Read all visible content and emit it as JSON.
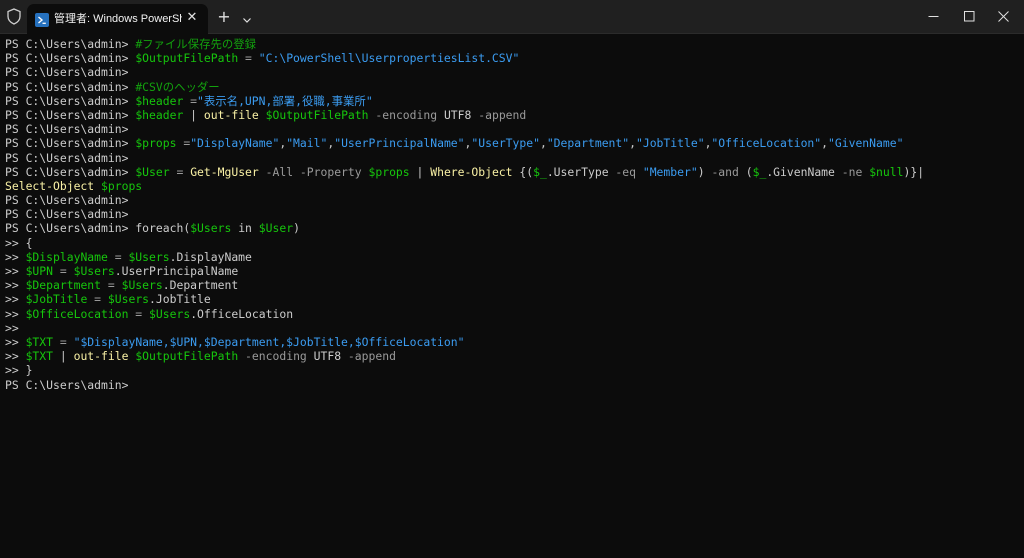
{
  "tab": {
    "title": "管理者: Windows PowerShell",
    "close_glyph": "✕",
    "new_tab_glyph": "+"
  },
  "window": {
    "minimize_icon": "minimize-icon",
    "maximize_icon": "maximize-icon",
    "close_icon": "close-icon"
  },
  "colors": {
    "background": "#0c0c0c",
    "titlebar": "#202020",
    "default_text": "#cccccc",
    "comment": "#13a10e",
    "variable": "#16c60c",
    "string": "#3b9cf1",
    "command": "#f9f1a5",
    "parameter": "#9a9a9a"
  },
  "terminal": {
    "lines": [
      [
        {
          "t": "PS C:\\Users\\admin> ",
          "c": "def"
        },
        {
          "t": "#ファイル保存先の登録",
          "c": "cmt"
        }
      ],
      [
        {
          "t": "PS C:\\Users\\admin> ",
          "c": "def"
        },
        {
          "t": "$OutputFilePath",
          "c": "var"
        },
        {
          "t": " = ",
          "c": "op"
        },
        {
          "t": "\"C:\\PowerShell\\UserpropertiesList.CSV\"",
          "c": "str"
        }
      ],
      [
        {
          "t": "PS C:\\Users\\admin>",
          "c": "def"
        }
      ],
      [
        {
          "t": "PS C:\\Users\\admin> ",
          "c": "def"
        },
        {
          "t": "#CSVのヘッダー",
          "c": "cmt"
        }
      ],
      [
        {
          "t": "PS C:\\Users\\admin> ",
          "c": "def"
        },
        {
          "t": "$header",
          "c": "var"
        },
        {
          "t": " =",
          "c": "op"
        },
        {
          "t": "\"表示名,UPN,部署,役職,事業所\"",
          "c": "str"
        }
      ],
      [
        {
          "t": "PS C:\\Users\\admin> ",
          "c": "def"
        },
        {
          "t": "$header",
          "c": "var"
        },
        {
          "t": " | ",
          "c": "bar"
        },
        {
          "t": "out-file",
          "c": "cmd"
        },
        {
          "t": " ",
          "c": "def"
        },
        {
          "t": "$OutputFilePath",
          "c": "var"
        },
        {
          "t": " -encoding ",
          "c": "par"
        },
        {
          "t": "UTF8",
          "c": "def"
        },
        {
          "t": " -append",
          "c": "par"
        }
      ],
      [
        {
          "t": "PS C:\\Users\\admin>",
          "c": "def"
        }
      ],
      [
        {
          "t": "PS C:\\Users\\admin> ",
          "c": "def"
        },
        {
          "t": "$props",
          "c": "var"
        },
        {
          "t": " =",
          "c": "op"
        },
        {
          "t": "\"DisplayName\"",
          "c": "str"
        },
        {
          "t": ",",
          "c": "def"
        },
        {
          "t": "\"Mail\"",
          "c": "str"
        },
        {
          "t": ",",
          "c": "def"
        },
        {
          "t": "\"UserPrincipalName\"",
          "c": "str"
        },
        {
          "t": ",",
          "c": "def"
        },
        {
          "t": "\"UserType\"",
          "c": "str"
        },
        {
          "t": ",",
          "c": "def"
        },
        {
          "t": "\"Department\"",
          "c": "str"
        },
        {
          "t": ",",
          "c": "def"
        },
        {
          "t": "\"JobTitle\"",
          "c": "str"
        },
        {
          "t": ",",
          "c": "def"
        },
        {
          "t": "\"OfficeLocation\"",
          "c": "str"
        },
        {
          "t": ",",
          "c": "def"
        },
        {
          "t": "\"GivenName\"",
          "c": "str"
        }
      ],
      [
        {
          "t": "PS C:\\Users\\admin>",
          "c": "def"
        }
      ],
      [
        {
          "t": "PS C:\\Users\\admin> ",
          "c": "def"
        },
        {
          "t": "$User",
          "c": "var"
        },
        {
          "t": " = ",
          "c": "op"
        },
        {
          "t": "Get-MgUser",
          "c": "cmd"
        },
        {
          "t": " -All -Property ",
          "c": "par"
        },
        {
          "t": "$props",
          "c": "var"
        },
        {
          "t": " | ",
          "c": "bar"
        },
        {
          "t": "Where-Object",
          "c": "cmd"
        },
        {
          "t": " {(",
          "c": "def"
        },
        {
          "t": "$_",
          "c": "var"
        },
        {
          "t": ".UserType ",
          "c": "def"
        },
        {
          "t": "-eq",
          "c": "par"
        },
        {
          "t": " ",
          "c": "def"
        },
        {
          "t": "\"Member\"",
          "c": "str"
        },
        {
          "t": ") ",
          "c": "def"
        },
        {
          "t": "-and",
          "c": "par"
        },
        {
          "t": " (",
          "c": "def"
        },
        {
          "t": "$_",
          "c": "var"
        },
        {
          "t": ".GivenName ",
          "c": "def"
        },
        {
          "t": "-ne",
          "c": "par"
        },
        {
          "t": " ",
          "c": "def"
        },
        {
          "t": "$null",
          "c": "var"
        },
        {
          "t": ")}|",
          "c": "def"
        }
      ],
      [
        {
          "t": "Select-Object",
          "c": "cmd"
        },
        {
          "t": " ",
          "c": "def"
        },
        {
          "t": "$props",
          "c": "var"
        }
      ],
      [
        {
          "t": "PS C:\\Users\\admin>",
          "c": "def"
        }
      ],
      [
        {
          "t": "PS C:\\Users\\admin>",
          "c": "def"
        }
      ],
      [
        {
          "t": "PS C:\\Users\\admin> ",
          "c": "def"
        },
        {
          "t": "foreach(",
          "c": "def"
        },
        {
          "t": "$Users",
          "c": "var"
        },
        {
          "t": " in ",
          "c": "def"
        },
        {
          "t": "$User",
          "c": "var"
        },
        {
          "t": ")",
          "c": "def"
        }
      ],
      [
        {
          "t": ">> {",
          "c": "def"
        }
      ],
      [
        {
          "t": ">> ",
          "c": "def"
        },
        {
          "t": "$DisplayName",
          "c": "var"
        },
        {
          "t": " = ",
          "c": "op"
        },
        {
          "t": "$Users",
          "c": "var"
        },
        {
          "t": ".DisplayName",
          "c": "def"
        }
      ],
      [
        {
          "t": ">> ",
          "c": "def"
        },
        {
          "t": "$UPN",
          "c": "var"
        },
        {
          "t": " = ",
          "c": "op"
        },
        {
          "t": "$Users",
          "c": "var"
        },
        {
          "t": ".UserPrincipalName",
          "c": "def"
        }
      ],
      [
        {
          "t": ">> ",
          "c": "def"
        },
        {
          "t": "$Department",
          "c": "var"
        },
        {
          "t": " = ",
          "c": "op"
        },
        {
          "t": "$Users",
          "c": "var"
        },
        {
          "t": ".Department",
          "c": "def"
        }
      ],
      [
        {
          "t": ">> ",
          "c": "def"
        },
        {
          "t": "$JobTitle",
          "c": "var"
        },
        {
          "t": " = ",
          "c": "op"
        },
        {
          "t": "$Users",
          "c": "var"
        },
        {
          "t": ".JobTitle",
          "c": "def"
        }
      ],
      [
        {
          "t": ">> ",
          "c": "def"
        },
        {
          "t": "$OfficeLocation",
          "c": "var"
        },
        {
          "t": " = ",
          "c": "op"
        },
        {
          "t": "$Users",
          "c": "var"
        },
        {
          "t": ".OfficeLocation",
          "c": "def"
        }
      ],
      [
        {
          "t": ">>",
          "c": "def"
        }
      ],
      [
        {
          "t": ">> ",
          "c": "def"
        },
        {
          "t": "$TXT",
          "c": "var"
        },
        {
          "t": " = ",
          "c": "op"
        },
        {
          "t": "\"$DisplayName,$UPN,$Department,$JobTitle,$OfficeLocation\"",
          "c": "str"
        }
      ],
      [
        {
          "t": ">> ",
          "c": "def"
        },
        {
          "t": "$TXT",
          "c": "var"
        },
        {
          "t": " | ",
          "c": "bar"
        },
        {
          "t": "out-file",
          "c": "cmd"
        },
        {
          "t": " ",
          "c": "def"
        },
        {
          "t": "$OutputFilePath",
          "c": "var"
        },
        {
          "t": " -encoding ",
          "c": "par"
        },
        {
          "t": "UTF8",
          "c": "def"
        },
        {
          "t": " -append",
          "c": "par"
        }
      ],
      [
        {
          "t": ">> }",
          "c": "def"
        }
      ],
      [
        {
          "t": "PS C:\\Users\\admin>",
          "c": "def"
        }
      ]
    ]
  }
}
